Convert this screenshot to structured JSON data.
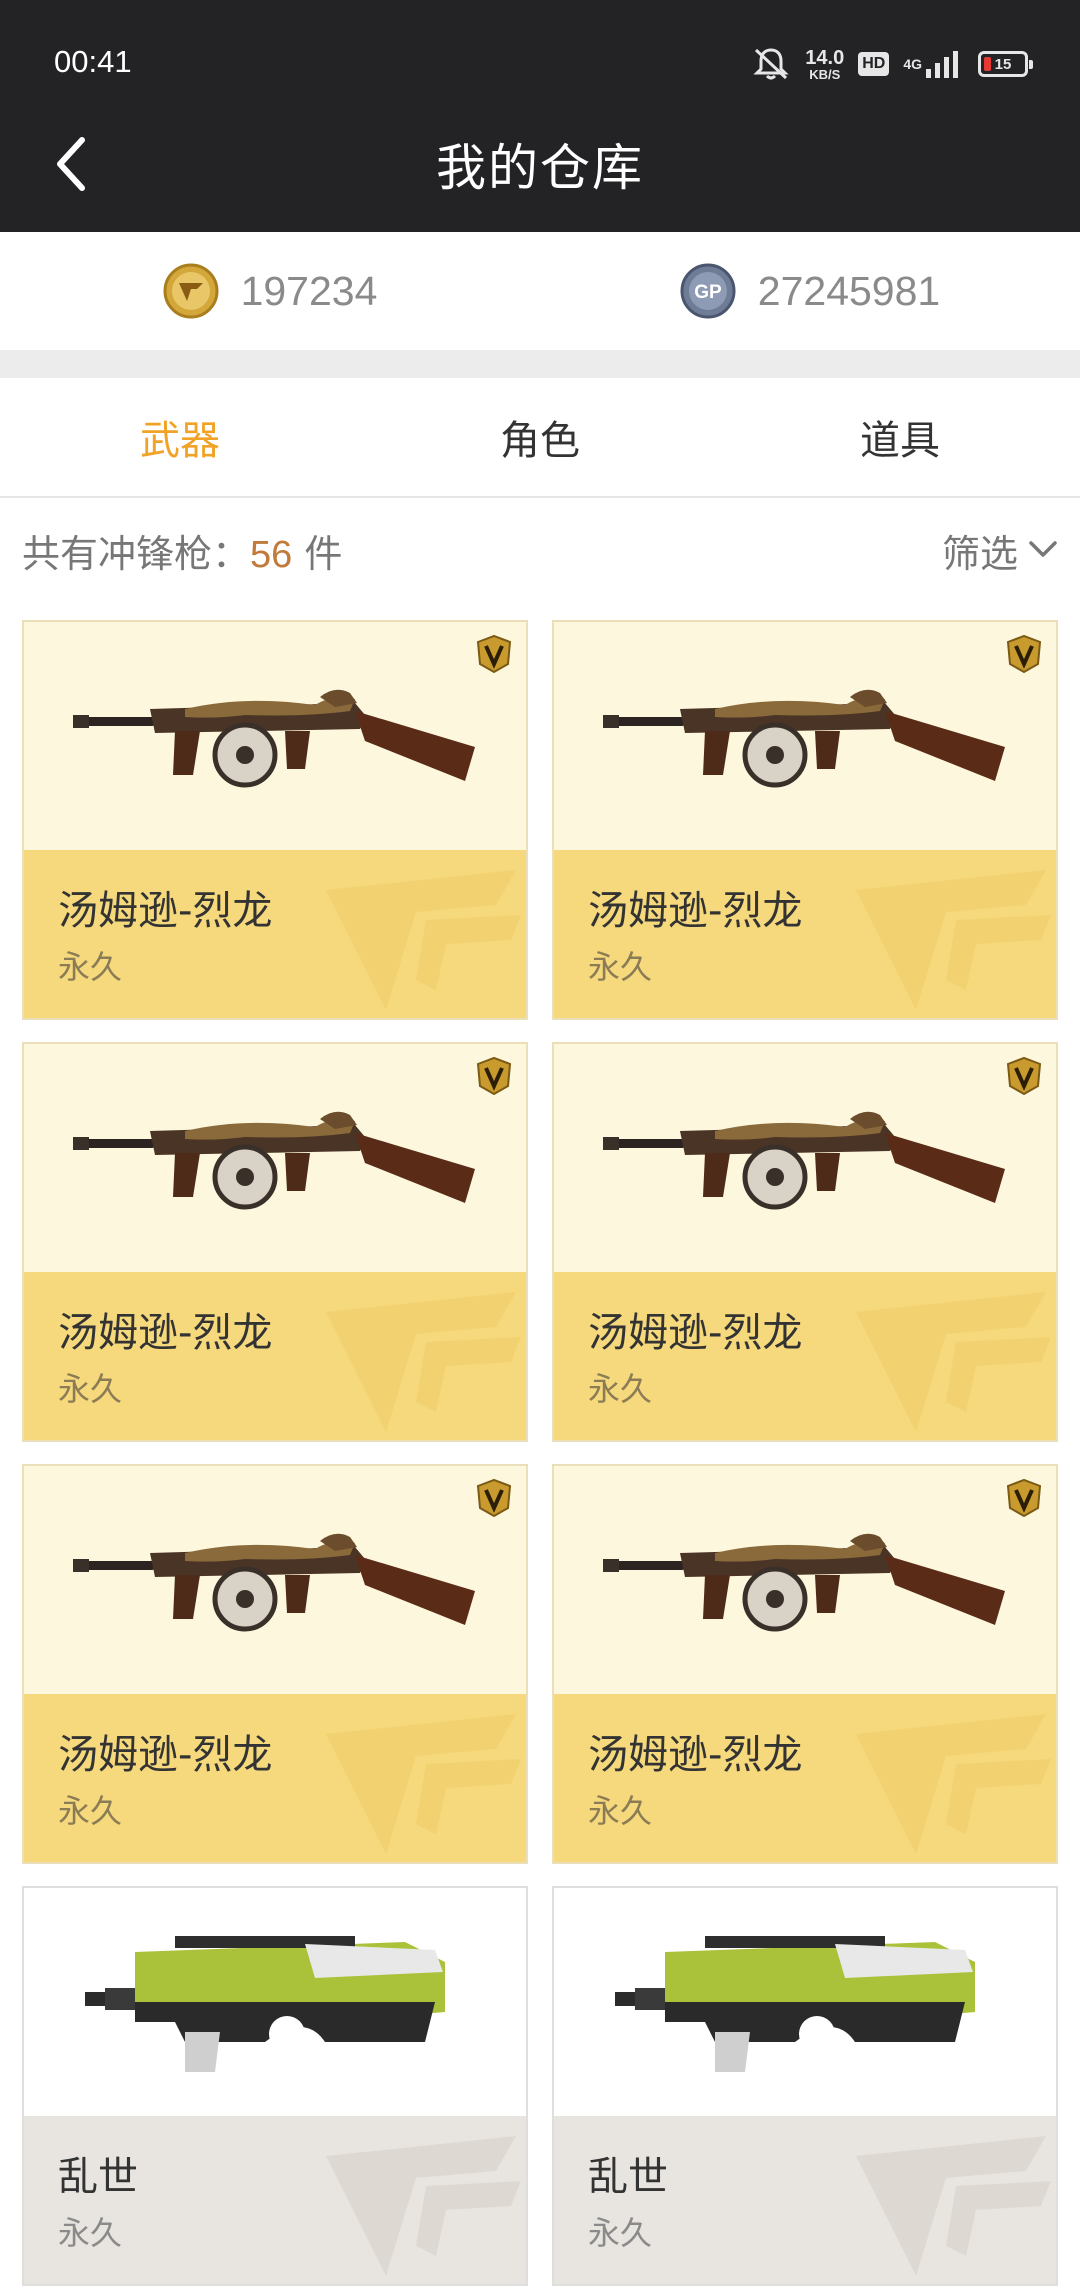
{
  "status_bar": {
    "time": "00:41",
    "net_speed_value": "14.0",
    "net_speed_unit": "KB/S",
    "hd_label": "HD",
    "network_label": "4G",
    "battery_level": "15"
  },
  "header": {
    "title": "我的仓库"
  },
  "currency": {
    "cf_points": "197234",
    "gp_label": "GP",
    "gp_points": "27245981"
  },
  "tabs": [
    {
      "label": "武器",
      "active": true
    },
    {
      "label": "角色",
      "active": false
    },
    {
      "label": "道具",
      "active": false
    }
  ],
  "summary": {
    "prefix": "共有冲锋枪：",
    "count": "56",
    "suffix": " 件",
    "filter_label": "筛选"
  },
  "items": [
    {
      "name": "汤姆逊-烈龙",
      "duration": "永久",
      "image": "thompson-dragon-gun",
      "vip": true,
      "style": "gold"
    },
    {
      "name": "汤姆逊-烈龙",
      "duration": "永久",
      "image": "thompson-dragon-gun",
      "vip": true,
      "style": "gold"
    },
    {
      "name": "汤姆逊-烈龙",
      "duration": "永久",
      "image": "thompson-dragon-gun",
      "vip": true,
      "style": "gold"
    },
    {
      "name": "汤姆逊-烈龙",
      "duration": "永久",
      "image": "thompson-dragon-gun",
      "vip": true,
      "style": "gold"
    },
    {
      "name": "汤姆逊-烈龙",
      "duration": "永久",
      "image": "thompson-dragon-gun",
      "vip": true,
      "style": "gold"
    },
    {
      "name": "汤姆逊-烈龙",
      "duration": "永久",
      "image": "thompson-dragon-gun",
      "vip": true,
      "style": "gold"
    },
    {
      "name": "乱世",
      "duration": "永久",
      "image": "p90-green-gun",
      "vip": false,
      "style": "grey"
    },
    {
      "name": "乱世",
      "duration": "永久",
      "image": "p90-green-gun",
      "vip": false,
      "style": "grey"
    }
  ],
  "colors": {
    "header_bg": "#232326",
    "accent": "#f0a326",
    "card_gold": "#f5d97c",
    "card_grey": "#e8e5e0"
  }
}
